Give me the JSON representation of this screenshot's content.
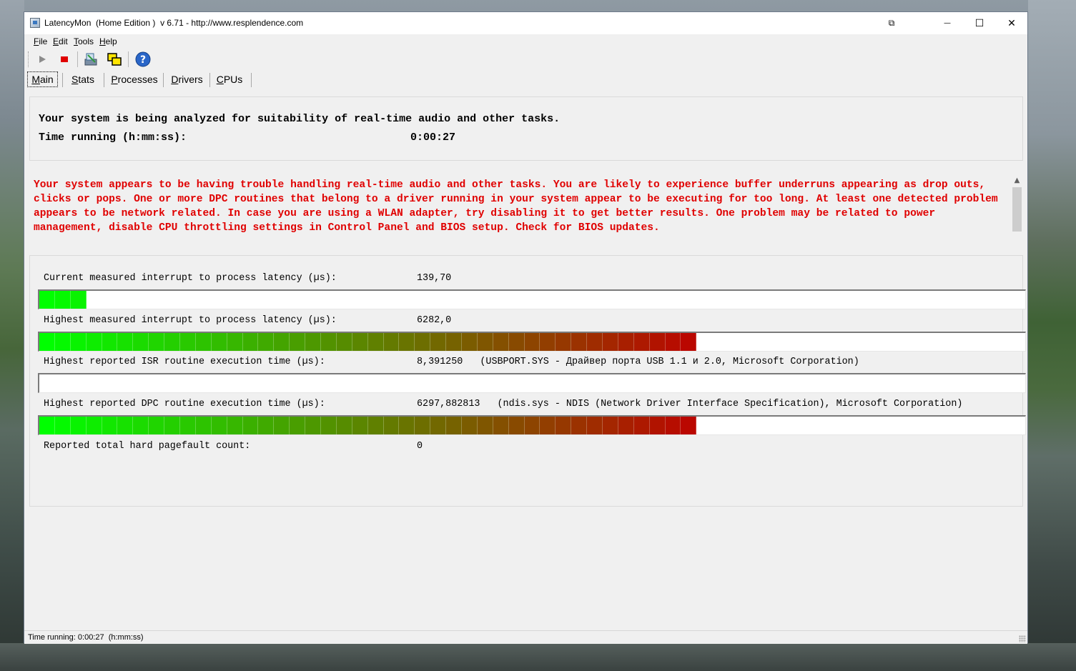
{
  "window": {
    "title": "LatencyMon  (Home Edition )  v 6.71 - http://www.resplendence.com",
    "controls": {
      "extra": "⧉",
      "minimize": "—",
      "maximize": "☐",
      "close": "✕"
    }
  },
  "menu": {
    "items": [
      "File",
      "Edit",
      "Tools",
      "Help"
    ]
  },
  "toolbar": {
    "icons": [
      "play-icon",
      "stop-icon",
      "wrench-icon",
      "windows-icon",
      "help-icon"
    ]
  },
  "tabs": {
    "items": [
      "Main",
      "Stats",
      "Processes",
      "Drivers",
      "CPUs"
    ],
    "active": "Main"
  },
  "main": {
    "analyzing_text": "Your system is being analyzed for suitability of real-time audio and other tasks.",
    "time_running_label": "Time running (h:mm:ss):",
    "time_running_value": "0:00:27",
    "warning_text": "Your system appears to be having trouble handling real-time audio and other tasks. You are likely to experience buffer underruns appearing as drop outs, clicks or pops. One or more DPC routines that belong to a driver running in your system appear to be executing for too long. At least one detected problem appears to be network related. In case you are using a WLAN adapter, try disabling it to get better results. One problem may be related to power management, disable CPU throttling settings in Control Panel and BIOS setup. Check for BIOS updates.",
    "warning_color": "#e00000",
    "metrics": {
      "current_latency": {
        "label": "Current measured interrupt to process latency (µs):",
        "value": "139,70",
        "bar_fraction": 0.044
      },
      "highest_latency": {
        "label": "Highest measured interrupt to process latency (µs):",
        "value": "6282,0",
        "bar_fraction": 0.668
      },
      "highest_isr": {
        "label": "Highest reported ISR routine execution time (µs):",
        "value": "8,391250   (USBPORT.SYS - Драйвер порта USB 1.1 и 2.0, Microsoft Corporation)",
        "bar_fraction": 0.0
      },
      "highest_dpc": {
        "label": "Highest reported DPC routine execution time (µs):",
        "value": "6297,882813   (ndis.sys - NDIS (Network Driver Interface Specification), Microsoft Corporation)",
        "bar_fraction": 0.668
      },
      "pagefault": {
        "label": "Reported total hard pagefault count:",
        "value": "0"
      }
    },
    "bar_colors": {
      "start": "#00ff00",
      "end": "#c00000"
    }
  },
  "statusbar": {
    "text": "Time running: 0:00:27  (h:mm:ss)"
  }
}
